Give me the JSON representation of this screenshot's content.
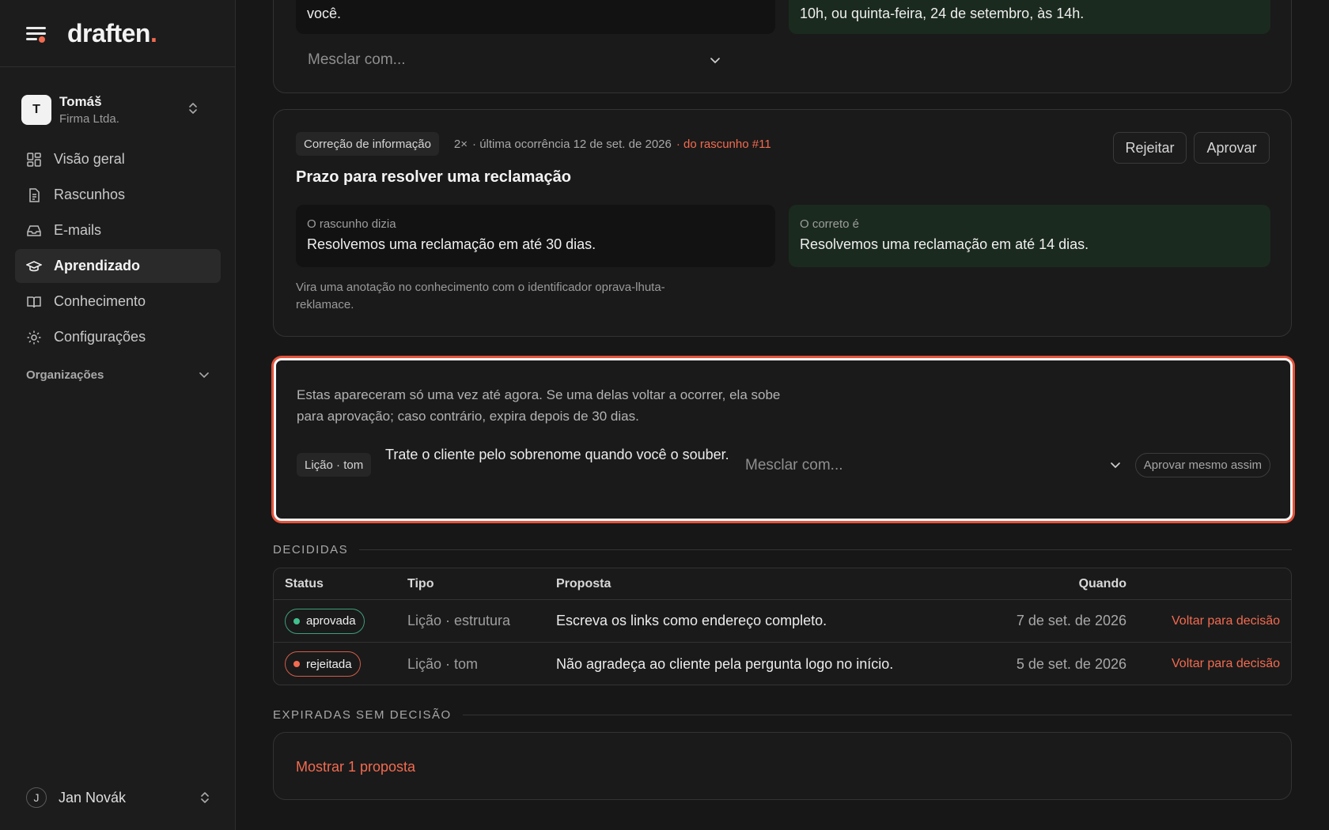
{
  "brand": {
    "logo": "draften",
    "logo_dot": "."
  },
  "account": {
    "initial": "T",
    "name": "Tomáš",
    "org": "Firma Ltda."
  },
  "nav": [
    {
      "label": "Visão geral",
      "icon": "grid-icon"
    },
    {
      "label": "Rascunhos",
      "icon": "document-icon"
    },
    {
      "label": "E-mails",
      "icon": "inbox-icon"
    },
    {
      "label": "Aprendizado",
      "icon": "graduation-cap-icon",
      "active": true
    },
    {
      "label": "Conhecimento",
      "icon": "book-icon"
    },
    {
      "label": "Configurações",
      "icon": "gear-icon"
    }
  ],
  "orgs_label": "Organizações",
  "user": {
    "initial": "J",
    "name": "Jan Novák"
  },
  "top_card": {
    "left_text": "você.",
    "right_text": "10h, ou quinta-feira, 24 de setembro, às 14h.",
    "merge_placeholder": "Mesclar com..."
  },
  "correction_card": {
    "tag": "Correção de informação",
    "count": "2×",
    "last_seen": "· última ocorrência 12 de set. de 2026",
    "draft_link": "· do rascunho #11",
    "reject_label": "Rejeitar",
    "approve_label": "Aprovar",
    "title": "Prazo para resolver uma reclamação",
    "was_label": "O rascunho dizia",
    "was_text": "Resolvemos uma reclamação em até 30 dias.",
    "correct_label": "O correto é",
    "correct_text": "Resolvemos uma reclamação em até 14 dias.",
    "note": "Vira uma anotação no conhecimento com o identificador oprava-lhuta-reklamace."
  },
  "single_card": {
    "intro": "Estas apareceram só uma vez até agora. Se uma delas voltar a ocorrer, ela sobe para aprovação; caso contrário, expira depois de 30 dias.",
    "tag": "Lição · tom",
    "text": "Trate o cliente pelo sobrenome quando você o souber.",
    "merge_placeholder": "Mesclar com...",
    "approve_anyway": "Aprovar mesmo assim"
  },
  "decided": {
    "heading": "DECIDIDAS",
    "columns": {
      "status": "Status",
      "tipo": "Tipo",
      "proposta": "Proposta",
      "quando": "Quando"
    },
    "rows": [
      {
        "status": "aprovada",
        "tipo": "Lição · estrutura",
        "proposta": "Escreva os links como endereço completo.",
        "quando": "7 de set. de 2026",
        "action": "Voltar para decisão"
      },
      {
        "status": "rejeitada",
        "tipo": "Lição · tom",
        "proposta": "Não agradeça ao cliente pela pergunta logo no início.",
        "quando": "5 de set. de 2026",
        "action": "Voltar para decisão"
      }
    ]
  },
  "expired": {
    "heading": "EXPIRADAS SEM DECISÃO",
    "show_label": "Mostrar 1 proposta"
  },
  "colors": {
    "accent": "#f26b50",
    "approved": "#41c08d",
    "highlight_border": "#e5533c"
  }
}
